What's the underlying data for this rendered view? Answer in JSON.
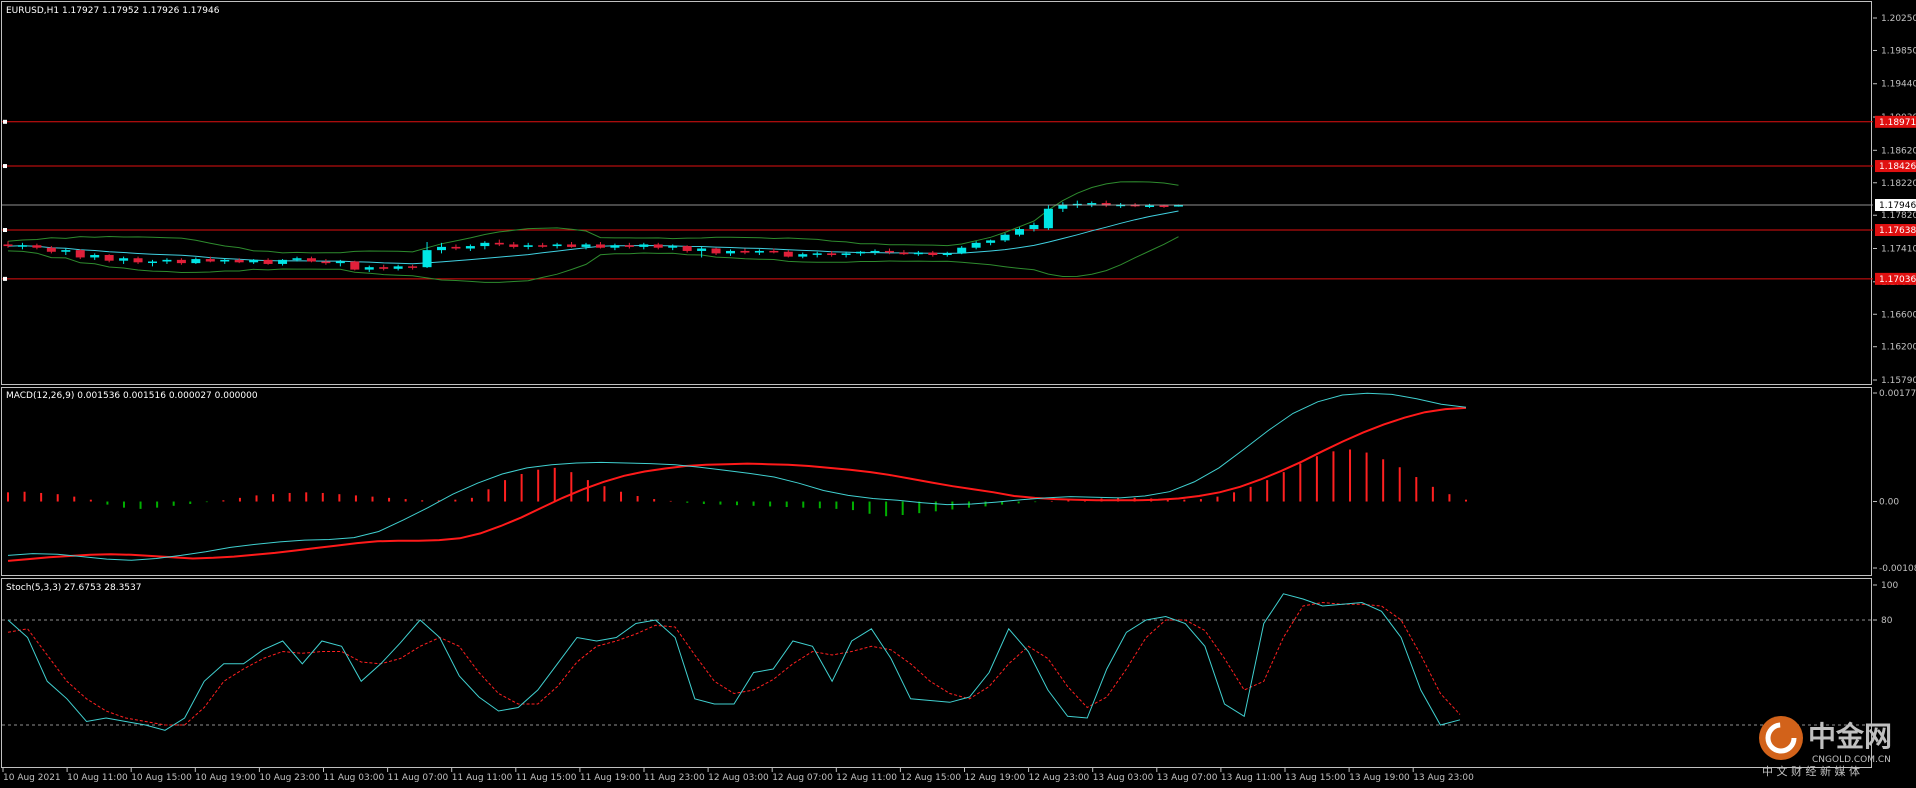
{
  "header": {
    "main_label": "EURUSD,H1  1.17927 1.17952 1.17926 1.17946",
    "macd_label": "MACD(12,26,9) 0.001536 0.001516 0.000027 0.000000",
    "stoch_label": "Stoch(5,3,3) 27.6753 28.3537"
  },
  "colors": {
    "background": "#000000",
    "axis": "#c0c0c0",
    "bull": "#00e5e5",
    "bear": "#e0203a",
    "level": "#e01010",
    "envelope": "#2e8b2e",
    "macd_signal": "#ff1a1a",
    "macd_main": "#40d0d0",
    "hist_pos": "#ff2020",
    "hist_neg": "#00b000",
    "stoch_main": "#40d0d0",
    "stoch_signal": "#ff2020"
  },
  "watermark": {
    "name": "中金网",
    "domain": "CNGOLD.COM.CN",
    "tagline": "中 文 财 经 新 媒 体"
  },
  "chart_data": [
    {
      "type": "candlestick",
      "title": "EURUSD,H1",
      "ohlc_last": [
        1.17927,
        1.17952,
        1.17926,
        1.17946
      ],
      "y_ticks": [
        "1.20250",
        "1.19850",
        "1.19440",
        "1.19030",
        "1.18620",
        "1.18220",
        "1.17820",
        "1.17410",
        "1.17000",
        "1.16600",
        "1.16200",
        "1.15790"
      ],
      "ylim": [
        1.1579,
        1.2025
      ],
      "current_price": "1.17946",
      "levels": [
        {
          "value": 1.18971,
          "label": "1.18971"
        },
        {
          "value": 1.18426,
          "label": "1.18426"
        },
        {
          "value": 1.17638,
          "label": "1.17638"
        },
        {
          "value": 1.17036,
          "label": "1.17036"
        }
      ],
      "x_labels": [
        "10 Aug 2021",
        "10 Aug 11:00",
        "10 Aug 15:00",
        "10 Aug 19:00",
        "10 Aug 23:00",
        "11 Aug 03:00",
        "11 Aug 07:00",
        "11 Aug 11:00",
        "11 Aug 15:00",
        "11 Aug 19:00",
        "11 Aug 23:00",
        "12 Aug 03:00",
        "12 Aug 07:00",
        "12 Aug 11:00",
        "12 Aug 15:00",
        "12 Aug 19:00",
        "12 Aug 23:00",
        "13 Aug 03:00",
        "13 Aug 07:00",
        "13 Aug 11:00",
        "13 Aug 15:00",
        "13 Aug 19:00",
        "13 Aug 23:00"
      ],
      "candles_ohlc": [
        [
          1.1746,
          1.175,
          1.1742,
          1.1744
        ],
        [
          1.1744,
          1.1748,
          1.174,
          1.1745
        ],
        [
          1.1745,
          1.1747,
          1.174,
          1.1742
        ],
        [
          1.1742,
          1.1744,
          1.1735,
          1.1737
        ],
        [
          1.1737,
          1.1741,
          1.1733,
          1.1739
        ],
        [
          1.1739,
          1.174,
          1.1728,
          1.173
        ],
        [
          1.173,
          1.1735,
          1.1727,
          1.1733
        ],
        [
          1.1733,
          1.1734,
          1.1724,
          1.1726
        ],
        [
          1.1726,
          1.1731,
          1.1722,
          1.1729
        ],
        [
          1.1729,
          1.1731,
          1.1722,
          1.1724
        ],
        [
          1.1724,
          1.1727,
          1.1719,
          1.1725
        ],
        [
          1.1725,
          1.1729,
          1.1722,
          1.1727
        ],
        [
          1.1727,
          1.1729,
          1.1721,
          1.1723
        ],
        [
          1.1723,
          1.173,
          1.1722,
          1.1728
        ],
        [
          1.1728,
          1.1731,
          1.1724,
          1.1725
        ],
        [
          1.1725,
          1.1729,
          1.1722,
          1.1727
        ],
        [
          1.1727,
          1.1729,
          1.1723,
          1.1724
        ],
        [
          1.1724,
          1.1728,
          1.1722,
          1.1727
        ],
        [
          1.1727,
          1.1729,
          1.1721,
          1.1722
        ],
        [
          1.1722,
          1.1728,
          1.172,
          1.1727
        ],
        [
          1.1727,
          1.1731,
          1.1725,
          1.1729
        ],
        [
          1.1729,
          1.1731,
          1.1724,
          1.1725
        ],
        [
          1.1725,
          1.1728,
          1.1721,
          1.1723
        ],
        [
          1.1723,
          1.1727,
          1.1719,
          1.1725
        ],
        [
          1.1725,
          1.1726,
          1.1714,
          1.1715
        ],
        [
          1.1715,
          1.172,
          1.1712,
          1.1718
        ],
        [
          1.1718,
          1.1721,
          1.1714,
          1.1716
        ],
        [
          1.1716,
          1.1721,
          1.1714,
          1.1719
        ],
        [
          1.1719,
          1.1721,
          1.1715,
          1.1718
        ],
        [
          1.1718,
          1.1749,
          1.1717,
          1.1739
        ],
        [
          1.1739,
          1.1748,
          1.1735,
          1.1743
        ],
        [
          1.1743,
          1.1746,
          1.1739,
          1.1741
        ],
        [
          1.1741,
          1.1746,
          1.1738,
          1.1744
        ],
        [
          1.1744,
          1.175,
          1.174,
          1.1748
        ],
        [
          1.1748,
          1.1752,
          1.1744,
          1.1746
        ],
        [
          1.1746,
          1.1749,
          1.1741,
          1.1743
        ],
        [
          1.1743,
          1.1748,
          1.174,
          1.1745
        ],
        [
          1.1745,
          1.1748,
          1.1742,
          1.1744
        ],
        [
          1.1744,
          1.1748,
          1.1741,
          1.1746
        ],
        [
          1.1746,
          1.1749,
          1.1742,
          1.1743
        ],
        [
          1.1743,
          1.1748,
          1.174,
          1.1746
        ],
        [
          1.1746,
          1.1749,
          1.1741,
          1.1742
        ],
        [
          1.1742,
          1.1747,
          1.1739,
          1.1745
        ],
        [
          1.1745,
          1.1748,
          1.1741,
          1.1743
        ],
        [
          1.1743,
          1.1748,
          1.174,
          1.1746
        ],
        [
          1.1746,
          1.1748,
          1.174,
          1.1742
        ],
        [
          1.1742,
          1.1746,
          1.1739,
          1.1744
        ],
        [
          1.1744,
          1.1745,
          1.1736,
          1.1738
        ],
        [
          1.1738,
          1.1743,
          1.173,
          1.1741
        ],
        [
          1.1741,
          1.1742,
          1.1733,
          1.1735
        ],
        [
          1.1735,
          1.174,
          1.1732,
          1.1738
        ],
        [
          1.1738,
          1.1741,
          1.1734,
          1.1736
        ],
        [
          1.1736,
          1.174,
          1.1733,
          1.1738
        ],
        [
          1.1738,
          1.1741,
          1.1735,
          1.1737
        ],
        [
          1.1737,
          1.1739,
          1.173,
          1.1731
        ],
        [
          1.1731,
          1.1736,
          1.1729,
          1.1734
        ],
        [
          1.1734,
          1.1737,
          1.173,
          1.1735
        ],
        [
          1.1735,
          1.1738,
          1.1731,
          1.1733
        ],
        [
          1.1733,
          1.1737,
          1.173,
          1.1735
        ],
        [
          1.1735,
          1.1738,
          1.1732,
          1.1737
        ],
        [
          1.1737,
          1.174,
          1.1733,
          1.1738
        ],
        [
          1.1738,
          1.1741,
          1.1734,
          1.1736
        ],
        [
          1.1736,
          1.1739,
          1.1733,
          1.1734
        ],
        [
          1.1734,
          1.1738,
          1.1732,
          1.1736
        ],
        [
          1.1736,
          1.1738,
          1.1731,
          1.1733
        ],
        [
          1.1733,
          1.1737,
          1.1731,
          1.1735
        ],
        [
          1.1735,
          1.1744,
          1.1734,
          1.1742
        ],
        [
          1.1742,
          1.175,
          1.174,
          1.1748
        ],
        [
          1.1748,
          1.1752,
          1.1745,
          1.1751
        ],
        [
          1.1751,
          1.176,
          1.1749,
          1.1758
        ],
        [
          1.1758,
          1.1767,
          1.1756,
          1.1765
        ],
        [
          1.1765,
          1.1773,
          1.1762,
          1.177
        ],
        [
          1.1766,
          1.1794,
          1.1764,
          1.179
        ],
        [
          1.179,
          1.1798,
          1.1786,
          1.1795
        ],
        [
          1.1795,
          1.18,
          1.1791,
          1.1796
        ],
        [
          1.1796,
          1.1799,
          1.1792,
          1.1797
        ],
        [
          1.1797,
          1.18,
          1.1792,
          1.1794
        ],
        [
          1.1794,
          1.1797,
          1.1791,
          1.1795
        ],
        [
          1.1795,
          1.1797,
          1.1792,
          1.1793
        ],
        [
          1.1793,
          1.1796,
          1.1791,
          1.1794
        ],
        [
          1.1794,
          1.1795,
          1.1791,
          1.1793
        ],
        [
          1.17927,
          1.17952,
          1.17926,
          1.17946
        ]
      ]
    },
    {
      "type": "line",
      "title": "MACD(12,26,9)",
      "values_text": "0.001536 0.001516 0.000027 0.000000",
      "y_ticks": [
        "0.001773",
        "0.00",
        "-0.001086"
      ],
      "ylim": [
        -0.001086,
        0.001773
      ],
      "series": [
        {
          "name": "MACD",
          "role": "histogram"
        },
        {
          "name": "Signal",
          "role": "signal_line"
        }
      ],
      "hist": [
        0.00015,
        0.00016,
        0.00014,
        0.00012,
        8e-05,
        3e-05,
        -5e-05,
        -0.0001,
        -0.00012,
        -0.0001,
        -7e-05,
        -4e-05,
        -1e-05,
        2e-05,
        6e-05,
        0.0001,
        0.00012,
        0.00014,
        0.00015,
        0.00014,
        0.00012,
        0.0001,
        8e-05,
        6e-05,
        4e-05,
        2e-05,
        2e-05,
        3e-05,
        6e-05,
        0.0002,
        0.00035,
        0.00045,
        0.00052,
        0.00055,
        0.00048,
        0.00035,
        0.00025,
        0.00016,
        9e-05,
        4e-05,
        1e-05,
        -2e-05,
        -4e-05,
        -5e-05,
        -6e-05,
        -7e-05,
        -8e-05,
        -9e-05,
        -0.0001,
        -0.00011,
        -0.00012,
        -0.00014,
        -0.0002,
        -0.00024,
        -0.00022,
        -0.00019,
        -0.00016,
        -0.00013,
        -0.0001,
        -8e-05,
        -5e-05,
        -3e-05,
        -1e-05,
        1e-05,
        3e-05,
        4e-05,
        5e-05,
        6e-05,
        6e-05,
        5e-05,
        4e-05,
        3e-05,
        4e-05,
        8e-05,
        0.00015,
        0.00024,
        0.00035,
        0.00048,
        0.00062,
        0.00074,
        0.00082,
        0.00085,
        0.0008,
        0.00069,
        0.00056,
        0.0004,
        0.00024,
        0.00012,
        3e-05
      ],
      "signal": [
        -0.00097,
        -0.00094,
        -0.00091,
        -0.00089,
        -0.00087,
        -0.00086,
        -0.00087,
        -0.00089,
        -0.00091,
        -0.00093,
        -0.00092,
        -0.0009,
        -0.00087,
        -0.00084,
        -0.0008,
        -0.00076,
        -0.00072,
        -0.00068,
        -0.00065,
        -0.00064,
        -0.00064,
        -0.00063,
        -0.0006,
        -0.00052,
        -0.0004,
        -0.00026,
        -0.0001,
        6e-05,
        0.0002,
        0.00032,
        0.00042,
        0.00049,
        0.00054,
        0.00058,
        0.0006,
        0.00061,
        0.00062,
        0.00061,
        0.0006,
        0.00058,
        0.00055,
        0.00052,
        0.00048,
        0.00043,
        0.00037,
        0.00031,
        0.00025,
        0.0002,
        0.00015,
        9e-05,
        6e-05,
        4e-05,
        3e-05,
        2e-05,
        2e-05,
        2e-05,
        3e-05,
        5e-05,
        9e-05,
        0.00015,
        0.00024,
        0.00036,
        0.0005,
        0.00065,
        0.00082,
        0.00098,
        0.00113,
        0.00126,
        0.00137,
        0.00146,
        0.00151,
        0.00153
      ],
      "macd": [
        -0.00088,
        -0.00085,
        -0.00086,
        -0.0009,
        -0.00094,
        -0.00096,
        -0.00093,
        -0.00088,
        -0.00082,
        -0.00075,
        -0.0007,
        -0.00066,
        -0.00063,
        -0.00062,
        -0.00059,
        -0.00049,
        -0.0003,
        -0.0001,
        0.00012,
        0.0003,
        0.00045,
        0.00055,
        0.0006,
        0.00063,
        0.00064,
        0.00063,
        0.00062,
        0.0006,
        0.00056,
        0.00051,
        0.00046,
        0.0004,
        0.0003,
        0.00018,
        0.0001,
        5e-05,
        2e-05,
        -2e-05,
        -5e-05,
        -4e-05,
        -1e-05,
        3e-05,
        6e-05,
        8e-05,
        7e-05,
        6e-05,
        9e-05,
        0.00016,
        0.00032,
        0.00055,
        0.00085,
        0.00116,
        0.00144,
        0.00163,
        0.00174,
        0.00177,
        0.00175,
        0.00168,
        0.00159,
        0.00154
      ]
    },
    {
      "type": "line",
      "title": "Stoch(5,3,3)",
      "values_text": "27.6753 28.3537",
      "y_ticks": [
        "100",
        "80"
      ],
      "ylim": [
        0,
        100
      ],
      "levels": [
        80,
        20
      ],
      "series": [
        {
          "name": "main",
          "values": [
            80,
            70,
            45,
            35,
            22,
            24,
            22,
            20,
            17,
            24,
            45,
            55,
            55,
            63,
            68,
            55,
            68,
            65,
            45,
            55,
            67,
            80,
            70,
            48,
            36,
            28,
            30,
            40,
            55,
            70,
            68,
            70,
            78,
            80,
            70,
            35,
            32,
            32,
            50,
            52,
            68,
            65,
            45,
            68,
            75,
            58,
            35,
            34,
            33,
            36,
            50,
            75,
            62,
            40,
            25,
            24,
            52,
            73,
            80,
            82,
            78,
            65,
            32,
            25,
            78,
            95,
            92,
            88,
            89,
            90,
            85,
            70,
            40,
            20,
            23
          ]
        },
        {
          "name": "signal",
          "values": [
            73,
            75,
            60,
            45,
            35,
            28,
            24,
            22,
            20,
            20,
            30,
            45,
            52,
            58,
            62,
            61,
            62,
            62,
            56,
            55,
            58,
            65,
            70,
            65,
            50,
            38,
            32,
            32,
            42,
            56,
            65,
            68,
            72,
            77,
            76,
            60,
            45,
            38,
            40,
            46,
            55,
            62,
            60,
            62,
            65,
            63,
            55,
            45,
            38,
            35,
            42,
            55,
            65,
            58,
            42,
            30,
            36,
            52,
            70,
            80,
            80,
            74,
            58,
            40,
            45,
            70,
            88,
            90,
            89,
            89,
            88,
            80,
            60,
            38,
            26
          ]
        }
      ]
    }
  ]
}
